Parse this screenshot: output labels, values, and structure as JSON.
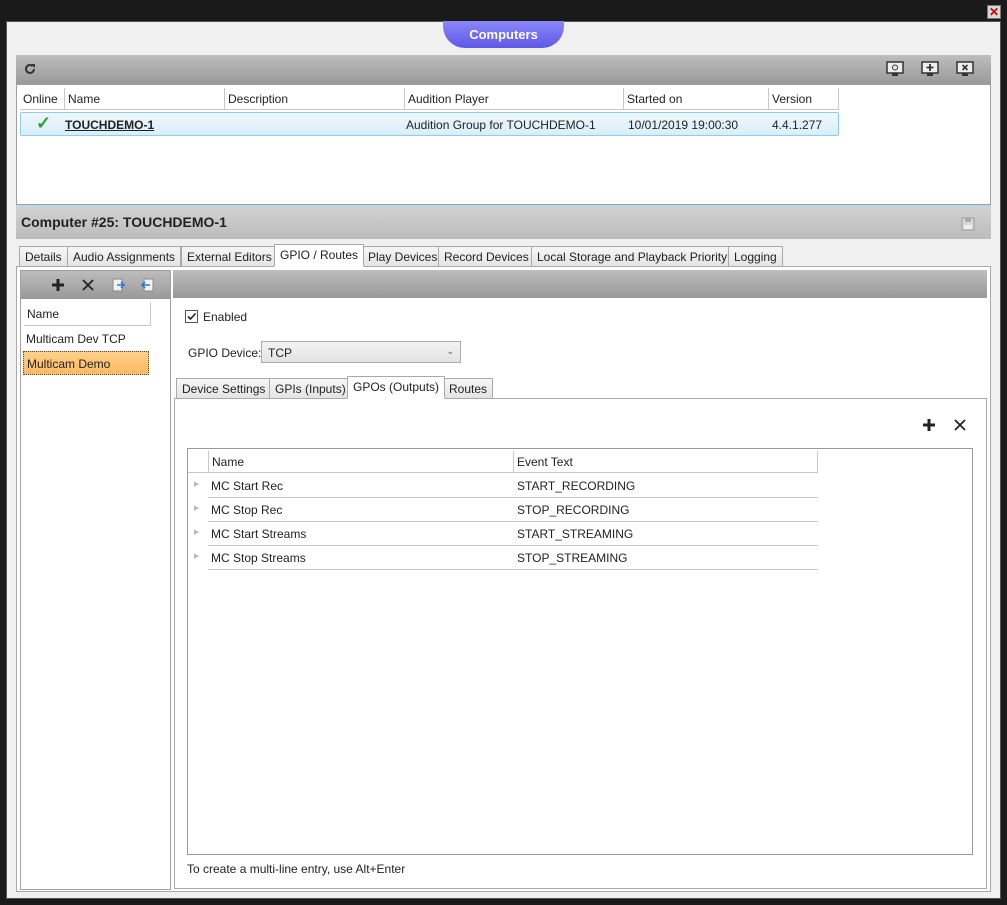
{
  "window": {
    "title": "Computers",
    "close_glyph": "✕"
  },
  "toolbar": {
    "refresh_icon": "refresh-icon",
    "right_icons": [
      "monitor-settings-icon",
      "monitor-add-icon",
      "monitor-remove-icon"
    ]
  },
  "computers_grid": {
    "headers": [
      "Online",
      "Name",
      "Description",
      "Audition Player",
      "Started on",
      "Version"
    ],
    "rows": [
      {
        "online": "✓",
        "name": "TOUCHDEMO-1",
        "description": "",
        "audition_player": "Audition Group for TOUCHDEMO-1",
        "started_on": "10/01/2019 19:00:30",
        "version": "4.4.1.277"
      }
    ]
  },
  "detail": {
    "title": "Computer #25: TOUCHDEMO-1"
  },
  "tabs": [
    "Details",
    "Audio Assignments",
    "External Editors",
    "GPIO / Routes",
    "Play Devices",
    "Record Devices",
    "Local Storage and Playback Priority",
    "Logging"
  ],
  "active_tab": "GPIO / Routes",
  "routes": {
    "header": "Name",
    "items": [
      "Multicam Dev TCP",
      "Multicam Demo"
    ],
    "selected": "Multicam Demo"
  },
  "gpio": {
    "enabled_label": "Enabled",
    "enabled": true,
    "device_label": "GPIO Device:",
    "device_value": "TCP",
    "inner_tabs": [
      "Device Settings",
      "GPIs (Inputs)",
      "GPOs (Outputs)",
      "Routes"
    ],
    "active_inner_tab": "GPOs (Outputs)",
    "gpo_grid": {
      "headers": [
        "Name",
        "Event Text"
      ],
      "rows": [
        {
          "name": "MC Start Rec",
          "event": "START_RECORDING"
        },
        {
          "name": "MC Stop Rec",
          "event": "STOP_RECORDING"
        },
        {
          "name": "MC Start Streams",
          "event": "START_STREAMING"
        },
        {
          "name": "MC Stop Streams",
          "event": "STOP_STREAMING"
        }
      ]
    },
    "hint": "To create a multi-line entry, use Alt+Enter"
  },
  "colors": {
    "accent": "#6c66f0",
    "selected_row": "#fbc573",
    "online_check": "#2ea02e"
  }
}
